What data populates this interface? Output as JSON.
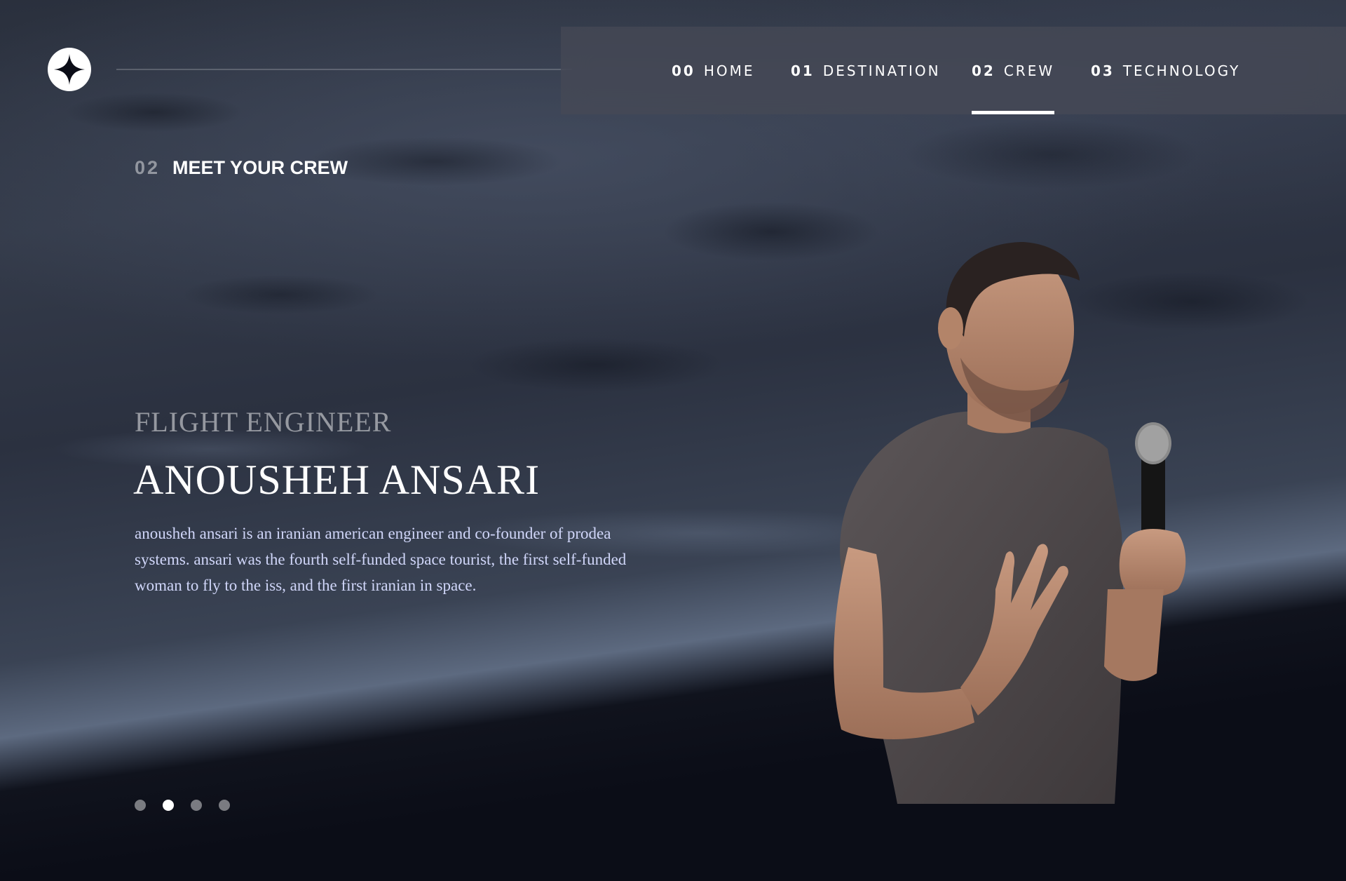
{
  "header": {
    "logo_icon": "star-icon"
  },
  "nav": {
    "items": [
      {
        "num": "00",
        "label": "HOME"
      },
      {
        "num": "01",
        "label": "DESTINATION"
      },
      {
        "num": "02",
        "label": "CREW"
      },
      {
        "num": "03",
        "label": "TECHNOLOGY"
      }
    ],
    "active_index": 2
  },
  "section": {
    "num": "02",
    "title": "MEET YOUR CREW"
  },
  "crew": {
    "role": "FLIGHT ENGINEER",
    "name": "ANOUSHEH ANSARI",
    "bio": "anousheh ansari is an iranian american engineer and co-founder of prodea systems. ansari was the fourth self-funded space tourist, the first self-funded woman to fly to the iss, and the first iranian in space."
  },
  "pagination": {
    "count": 4,
    "active_index": 1
  },
  "colors": {
    "background": "#0b0d17",
    "text_primary": "#ffffff",
    "text_secondary": "#d0d6f9"
  }
}
